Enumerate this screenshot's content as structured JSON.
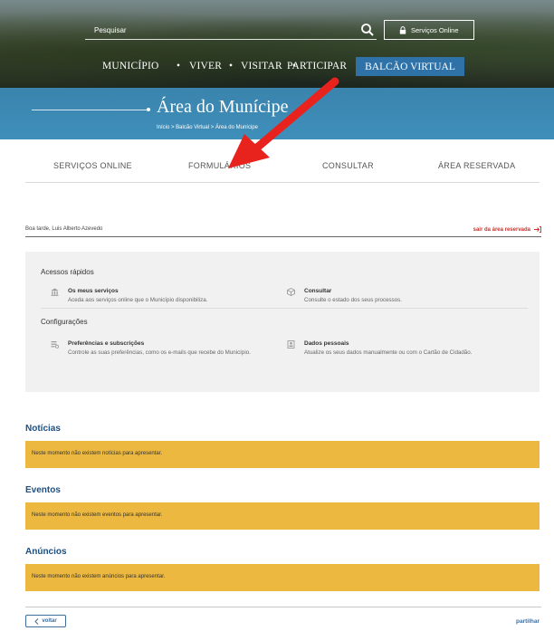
{
  "header": {
    "search": {
      "placeholder": "Pesquisar",
      "value": ""
    },
    "online_button": "Serviços Online",
    "nav": {
      "municipio": "MUNICÍPIO",
      "viver": "VIVER",
      "visitar": "VISITAR",
      "participar": "PARTICIPAR",
      "balcao": "BALCÃO VIRTUAL",
      "separator": "•"
    }
  },
  "banner": {
    "title": "Área do Munícipe",
    "breadcrumb": "Início  >  Balcão Virtual  >  Área do Munícipe"
  },
  "tabs": {
    "servicos": "SERVIÇOS ONLINE",
    "formularios": "FORMULÁRIOS",
    "consultar": "CONSULTAR",
    "reservada": "ÁREA RESERVADA"
  },
  "user": {
    "greeting": "Boa tarde, Luis Alberto Azevedo",
    "logout": "sair da área reservada"
  },
  "panel": {
    "quick_access": {
      "heading": "Acessos rápidos",
      "items": [
        {
          "title": "Os meus serviços",
          "desc": "Aceda aos serviços online que o Município disponibiliza.",
          "icon": "building-icon"
        },
        {
          "title": "Consultar",
          "desc": "Consulte o estado dos seus processos.",
          "icon": "box-icon"
        }
      ]
    },
    "settings": {
      "heading": "Configurações",
      "items": [
        {
          "title": "Preferências e subscrições",
          "desc": "Controle as suas preferências, como os e-mails que recebe do Município.",
          "icon": "preferences-icon"
        },
        {
          "title": "Dados pessoais",
          "desc": "Atualize os seus dados manualmente ou com o Cartão de Cidadão.",
          "icon": "id-card-icon"
        }
      ]
    }
  },
  "sections": {
    "noticias": {
      "title": "Notícias",
      "empty": "Neste momento não existem notícias para apresentar."
    },
    "eventos": {
      "title": "Eventos",
      "empty": "Neste momento não existem eventos para apresentar."
    },
    "anuncios": {
      "title": "Anúncios",
      "empty": "Neste momento não existem anúncios para apresentar."
    }
  },
  "footer": {
    "back": "voltar",
    "share": "partilhar"
  },
  "colors": {
    "accent_blue": "#3f8fbb",
    "nav_active": "#2f72a8",
    "section_title": "#1f4f7e",
    "notice_yellow": "#ecb83f",
    "logout_red": "#c8322a",
    "annotation_arrow": "#e8231d"
  }
}
